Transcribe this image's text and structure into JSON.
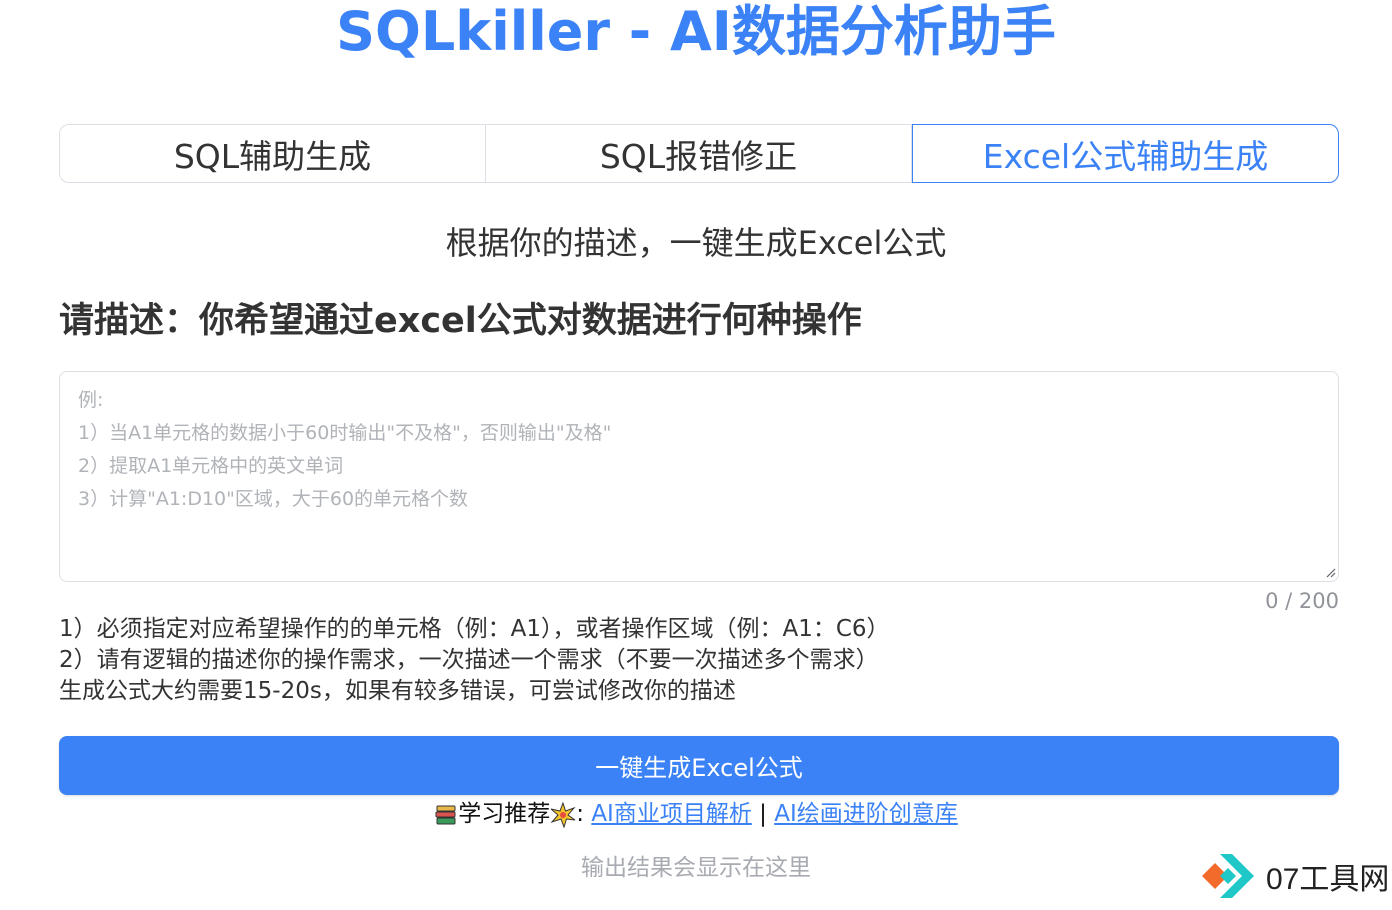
{
  "header": {
    "title": "SQLkiller - AI数据分析助手"
  },
  "tabs": [
    {
      "label": "SQL辅助生成",
      "active": false
    },
    {
      "label": "SQL报错修正",
      "active": false
    },
    {
      "label": "Excel公式辅助生成",
      "active": true
    }
  ],
  "main": {
    "subtitle": "根据你的描述，一键生成Excel公式",
    "prompt_heading": "请描述：你希望通过excel公式对数据进行何种操作",
    "input": {
      "value": "",
      "placeholder": "例:\n1）当A1单元格的数据小于60时输出\"不及格\"，否则输出\"及格\"\n2）提取A1单元格中的英文单词\n3）计算\"A1:D10\"区域，大于60的单元格个数",
      "counter": "0 / 200"
    },
    "instructions": [
      "1）必须指定对应希望操作的的单元格（例：A1），或者操作区域（例：A1：C6）",
      "2）请有逻辑的描述你的操作需求，一次描述一个需求（不要一次描述多个需求）",
      "生成公式大约需要15-20s，如果有较多错误，可尝试修改你的描述"
    ],
    "generate_button": "一键生成Excel公式",
    "recommend": {
      "prefix_icon": "books-icon",
      "label": "学习推荐",
      "burst_icon": "sparkle-burst-icon",
      "colon": ":",
      "link1": "AI商业项目解析",
      "separator": "|",
      "link2": "AI绘画进阶创意库"
    },
    "output_placeholder": "输出结果会显示在这里"
  },
  "watermark": {
    "text": "07工具网"
  },
  "colors": {
    "accent": "#3b82f6",
    "border": "#dcdfe6",
    "placeholder": "#b0b3b8",
    "logo_orange": "#f26b2a",
    "logo_teal": "#1ec8c8"
  }
}
